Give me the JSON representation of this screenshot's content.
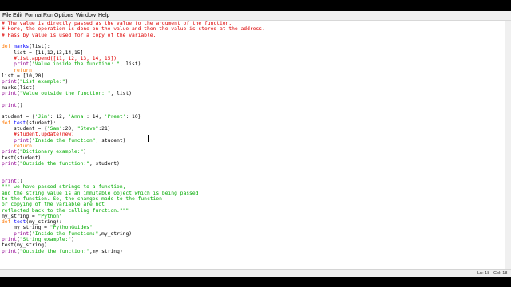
{
  "menu": [
    "File",
    "Edit",
    "Format",
    "Run",
    "Options",
    "Window",
    "Help"
  ],
  "code_lines": [
    [
      {
        "t": "# The value is directly passed as the value to the argument of the function.",
        "c": "comment"
      }
    ],
    [
      {
        "t": "# Here, the operation is done on the value and then the value is stored at the address.",
        "c": "comment"
      }
    ],
    [
      {
        "t": "# Pass by value is used for a copy of the variable.",
        "c": "comment"
      }
    ],
    [],
    [
      {
        "t": "def ",
        "c": "keyword"
      },
      {
        "t": "marks",
        "c": "def"
      },
      {
        "t": "(list):",
        "c": "plain"
      }
    ],
    [
      {
        "t": "    list = [11,12,13,14,15]",
        "c": "plain"
      }
    ],
    [
      {
        "t": "    #list.append([11, 12, 13, 14, 15])",
        "c": "comment"
      }
    ],
    [
      {
        "t": "    ",
        "c": "plain"
      },
      {
        "t": "print",
        "c": "builtin"
      },
      {
        "t": "(",
        "c": "plain"
      },
      {
        "t": "\"Value inside the function: \"",
        "c": "string"
      },
      {
        "t": ", list)",
        "c": "plain"
      }
    ],
    [
      {
        "t": "    return",
        "c": "keyword"
      }
    ],
    [
      {
        "t": "list = [10,20]",
        "c": "plain"
      }
    ],
    [
      {
        "t": "print",
        "c": "builtin"
      },
      {
        "t": "(",
        "c": "plain"
      },
      {
        "t": "\"List example:\"",
        "c": "string"
      },
      {
        "t": ")",
        "c": "plain"
      }
    ],
    [
      {
        "t": "marks(list)",
        "c": "plain"
      }
    ],
    [
      {
        "t": "print",
        "c": "builtin"
      },
      {
        "t": "(",
        "c": "plain"
      },
      {
        "t": "\"Value outside the function: \"",
        "c": "string"
      },
      {
        "t": ", list)",
        "c": "plain"
      }
    ],
    [],
    [
      {
        "t": "print",
        "c": "builtin"
      },
      {
        "t": "()",
        "c": "plain"
      }
    ],
    [],
    [
      {
        "t": "student = {",
        "c": "plain"
      },
      {
        "t": "'Jim'",
        "c": "string"
      },
      {
        "t": ": 12, ",
        "c": "plain"
      },
      {
        "t": "'Anna'",
        "c": "string"
      },
      {
        "t": ": 14, ",
        "c": "plain"
      },
      {
        "t": "'Preet'",
        "c": "string"
      },
      {
        "t": ": 10}",
        "c": "plain"
      }
    ],
    [
      {
        "t": "def ",
        "c": "keyword"
      },
      {
        "t": "test",
        "c": "def"
      },
      {
        "t": "(student):",
        "c": "plain"
      }
    ],
    [
      {
        "t": "    student = {",
        "c": "plain"
      },
      {
        "t": "'Sam'",
        "c": "string"
      },
      {
        "t": ":20, ",
        "c": "plain"
      },
      {
        "t": "\"Steve\"",
        "c": "string"
      },
      {
        "t": ":21}",
        "c": "plain"
      }
    ],
    [
      {
        "t": "    #student.update(new)",
        "c": "comment"
      }
    ],
    [
      {
        "t": "    ",
        "c": "plain"
      },
      {
        "t": "print",
        "c": "builtin"
      },
      {
        "t": "(",
        "c": "plain"
      },
      {
        "t": "\"Inside the function\"",
        "c": "string"
      },
      {
        "t": ", student)",
        "c": "plain"
      }
    ],
    [
      {
        "t": "    return",
        "c": "keyword"
      }
    ],
    [
      {
        "t": "print",
        "c": "builtin"
      },
      {
        "t": "(",
        "c": "plain"
      },
      {
        "t": "\"Dictionary example:\"",
        "c": "string"
      },
      {
        "t": ")",
        "c": "plain"
      }
    ],
    [
      {
        "t": "test(student)",
        "c": "plain"
      }
    ],
    [
      {
        "t": "print",
        "c": "builtin"
      },
      {
        "t": "(",
        "c": "plain"
      },
      {
        "t": "\"Outside the function:\"",
        "c": "string"
      },
      {
        "t": ", student)",
        "c": "plain"
      }
    ],
    [],
    [],
    [
      {
        "t": "print",
        "c": "builtin"
      },
      {
        "t": "()",
        "c": "plain"
      }
    ],
    [
      {
        "t": "\"\"\" we have passed strings to a function,",
        "c": "string"
      }
    ],
    [
      {
        "t": "and the string value is an immutable object which is being passed",
        "c": "string"
      }
    ],
    [
      {
        "t": "to the function. So, the changes made to the function",
        "c": "string"
      }
    ],
    [
      {
        "t": "or copying of the variable are not",
        "c": "string"
      }
    ],
    [
      {
        "t": "reflected back to the calling function.\"\"\"",
        "c": "string"
      }
    ],
    [
      {
        "t": "my_string = ",
        "c": "plain"
      },
      {
        "t": "\"Python\"",
        "c": "string"
      }
    ],
    [
      {
        "t": "def ",
        "c": "keyword"
      },
      {
        "t": "test",
        "c": "def"
      },
      {
        "t": "(my_string):",
        "c": "plain"
      }
    ],
    [
      {
        "t": "    my_string = ",
        "c": "plain"
      },
      {
        "t": "\"PythonGuides\"",
        "c": "string"
      }
    ],
    [
      {
        "t": "    ",
        "c": "plain"
      },
      {
        "t": "print",
        "c": "builtin"
      },
      {
        "t": "(",
        "c": "plain"
      },
      {
        "t": "\"Inside the function:\"",
        "c": "string"
      },
      {
        "t": ",my_string)",
        "c": "plain"
      }
    ],
    [
      {
        "t": "print",
        "c": "builtin"
      },
      {
        "t": "(",
        "c": "plain"
      },
      {
        "t": "\"String example:\"",
        "c": "string"
      },
      {
        "t": ")",
        "c": "plain"
      }
    ],
    [
      {
        "t": "test(my_string)",
        "c": "plain"
      }
    ],
    [
      {
        "t": "print",
        "c": "builtin"
      },
      {
        "t": "(",
        "c": "plain"
      },
      {
        "t": "\"Outside the function:\"",
        "c": "string"
      },
      {
        "t": ",my_string)",
        "c": "plain"
      }
    ]
  ],
  "status": {
    "line": "Ln: 18",
    "col": "Col: 18"
  }
}
